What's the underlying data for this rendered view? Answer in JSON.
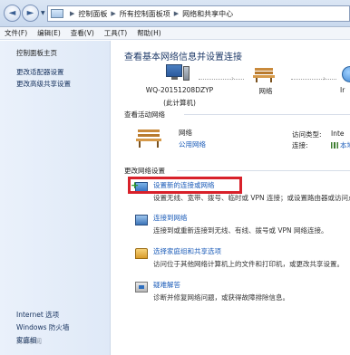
{
  "address_bar": {
    "crumbs": [
      "控制面板",
      "所有控制面板项",
      "网络和共享中心"
    ]
  },
  "menu": [
    "文件(F)",
    "编辑(E)",
    "查看(V)",
    "工具(T)",
    "帮助(H)"
  ],
  "sidebar": {
    "home": "控制面板主页",
    "links": [
      "更改适配器设置",
      "更改高级共享设置"
    ],
    "see_also_title": "另请参阅",
    "see_also": [
      "Internet 选项",
      "Windows 防火墙",
      "家庭组"
    ]
  },
  "main": {
    "title": "查看基本网络信息并设置连接",
    "map": {
      "computer_name": "WQ-20151208DZYP",
      "computer_sub": "(此计算机)",
      "network": "网络",
      "internet": "Ir"
    },
    "active_section": "查看活动网络",
    "active": {
      "name": "网络",
      "type": "公用网络",
      "access_label": "访问类型:",
      "access_value": "Inte",
      "conn_label": "连接:",
      "conn_value": "本地"
    },
    "change_section": "更改网络设置",
    "tasks": [
      {
        "title": "设置新的连接或网络",
        "desc": "设置无线、宽带、拨号、临时或 VPN 连接；或设置路由器或访问点。",
        "icon": "new-connection-icon"
      },
      {
        "title": "连接到网络",
        "desc": "连接到或重新连接到无线、有线、拨号或 VPN 网络连接。",
        "icon": "connect-network-icon"
      },
      {
        "title": "选择家庭组和共享选项",
        "desc": "访问位于其他网络计算机上的文件和打印机，或更改共享设置。",
        "icon": "homegroup-icon"
      },
      {
        "title": "疑难解答",
        "desc": "诊断并修复网络问题，或获得故障排除信息。",
        "icon": "troubleshoot-icon"
      }
    ]
  },
  "colors": {
    "highlight": "#d8212a",
    "link": "#1a5bb8",
    "sidebar_bg": "#e4edf9"
  }
}
